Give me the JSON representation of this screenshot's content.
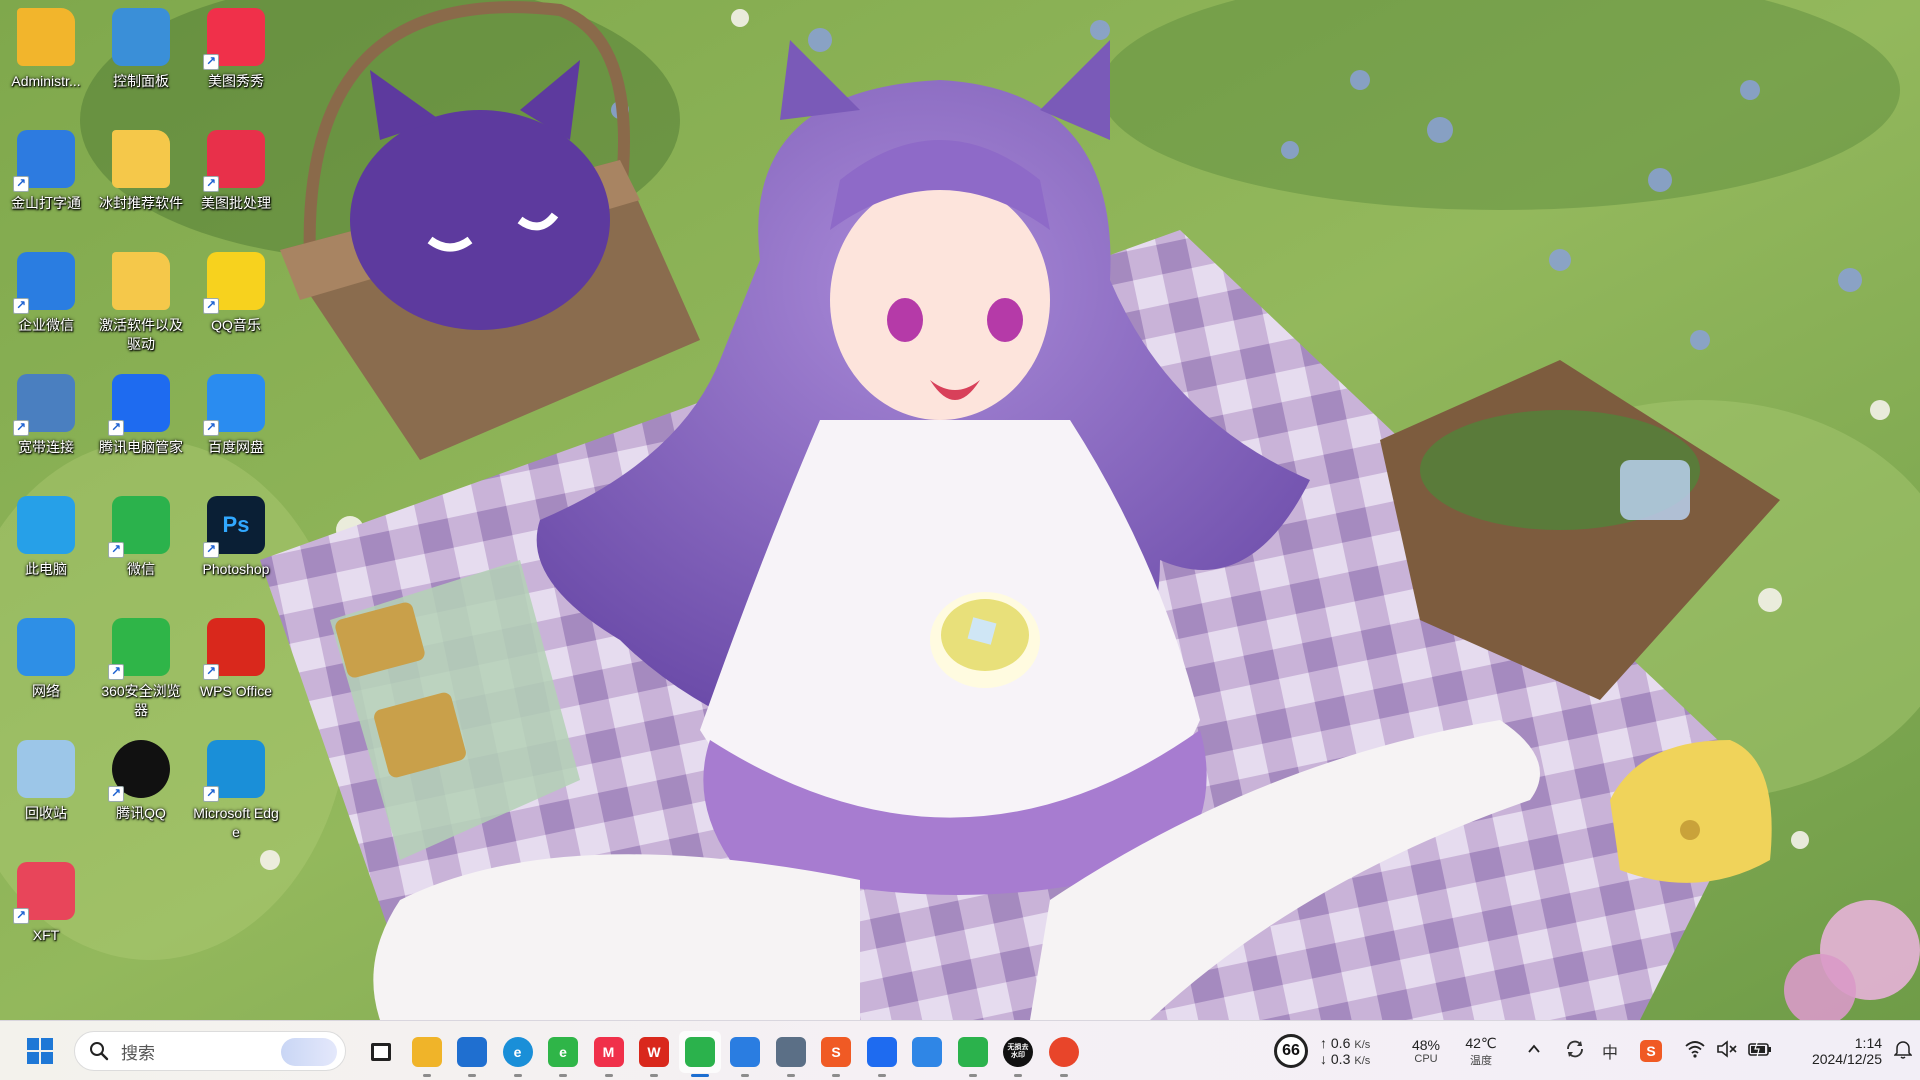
{
  "desktop": {
    "icons": [
      {
        "label": "Administr...",
        "icon": "user-folder-icon",
        "color": "#f2b52c"
      },
      {
        "label": "控制面板",
        "icon": "control-panel-icon",
        "color": "#3a8fd8"
      },
      {
        "label": "美图秀秀",
        "icon": "meitu-icon",
        "color": "#f0304a"
      },
      {
        "label": "金山打字通",
        "icon": "kingsoft-typing-icon",
        "color": "#2d7be0"
      },
      {
        "label": "冰封推荐软件",
        "icon": "folder-icon",
        "color": "#f5c84a"
      },
      {
        "label": "美图批处理",
        "icon": "meitu-batch-icon",
        "color": "#e8304a"
      },
      {
        "label": "企业微信",
        "icon": "wecom-icon",
        "color": "#2a7de1"
      },
      {
        "label": "激活软件以及驱动",
        "icon": "folder-icon",
        "color": "#f5c84a"
      },
      {
        "label": "QQ音乐",
        "icon": "qq-music-icon",
        "color": "#f7d21e"
      },
      {
        "label": "宽带连接",
        "icon": "broadband-icon",
        "color": "#4a7fc0"
      },
      {
        "label": "腾讯电脑管家",
        "icon": "tencent-pc-manager-icon",
        "color": "#1e6bf0"
      },
      {
        "label": "百度网盘",
        "icon": "baidu-netdisk-icon",
        "color": "#2a8cf0"
      },
      {
        "label": "此电脑",
        "icon": "this-pc-icon",
        "color": "#26a0e8"
      },
      {
        "label": "微信",
        "icon": "wechat-icon",
        "color": "#2bb24c"
      },
      {
        "label": "Photoshop",
        "icon": "photoshop-icon",
        "color": "#0a1f35"
      },
      {
        "label": "网络",
        "icon": "network-icon",
        "color": "#2e8fe6"
      },
      {
        "label": "360安全浏览器",
        "icon": "360-browser-icon",
        "color": "#2fb548"
      },
      {
        "label": "WPS Office",
        "icon": "wps-office-icon",
        "color": "#d9281c"
      },
      {
        "label": "回收站",
        "icon": "recycle-bin-icon",
        "color": "#9cc6e8"
      },
      {
        "label": "腾讯QQ",
        "icon": "qq-icon",
        "color": "#111111"
      },
      {
        "label": "Microsoft Edge",
        "icon": "edge-icon",
        "color": "#1a8fd8"
      },
      {
        "label": "XFT",
        "icon": "xft-icon",
        "color": "#e8455a"
      }
    ]
  },
  "taskbar": {
    "search_placeholder": "搜索",
    "apps": [
      {
        "name": "task-view",
        "icon": "task-view-icon",
        "color": "#333333",
        "text": ""
      },
      {
        "name": "file-explorer",
        "icon": "folder-icon",
        "color": "#f0b429",
        "text": ""
      },
      {
        "name": "microsoft-store",
        "icon": "store-icon",
        "color": "#1f6fd0",
        "text": ""
      },
      {
        "name": "edge",
        "icon": "edge-icon",
        "color": "#1a8fd8",
        "text": "e"
      },
      {
        "name": "360-browser",
        "icon": "360-browser-icon",
        "color": "#2fb548",
        "text": "e"
      },
      {
        "name": "meitu",
        "icon": "meitu-icon",
        "color": "#f0304a",
        "text": "M"
      },
      {
        "name": "wps",
        "icon": "wps-icon",
        "color": "#d9281c",
        "text": "W"
      },
      {
        "name": "wechat",
        "icon": "wechat-icon",
        "color": "#2bb24c",
        "text": ""
      },
      {
        "name": "window-app",
        "icon": "window-icon",
        "color": "#2a7de1",
        "text": ""
      },
      {
        "name": "settings",
        "icon": "gear-icon",
        "color": "#5b6f86",
        "text": ""
      },
      {
        "name": "sogou-input",
        "icon": "sogou-icon",
        "color": "#f05a24",
        "text": "S"
      },
      {
        "name": "tencent-pc-manager",
        "icon": "shield-icon",
        "color": "#1e6bf0",
        "text": ""
      },
      {
        "name": "diamond-app",
        "icon": "diamond-icon",
        "color": "#2f86e6",
        "text": ""
      },
      {
        "name": "remote-desktop",
        "icon": "monitor-icon",
        "color": "#2bb24c",
        "text": ""
      },
      {
        "name": "watermark-tool",
        "icon": "watermark-icon",
        "color": "#111111",
        "text": "无损去水印"
      },
      {
        "name": "color-app",
        "icon": "color-wheel-icon",
        "color": "#e8452a",
        "text": ""
      }
    ],
    "tray": {
      "score": "66",
      "net_up": "↑ 0.6",
      "net_up_unit": "K/s",
      "net_down": "↓ 0.3",
      "net_down_unit": "K/s",
      "cpu_value": "48%",
      "cpu_label": "CPU",
      "temp_value": "42℃",
      "temp_label": "温度",
      "ime": "中",
      "time": "1:14",
      "date": "2024/12/25"
    }
  }
}
